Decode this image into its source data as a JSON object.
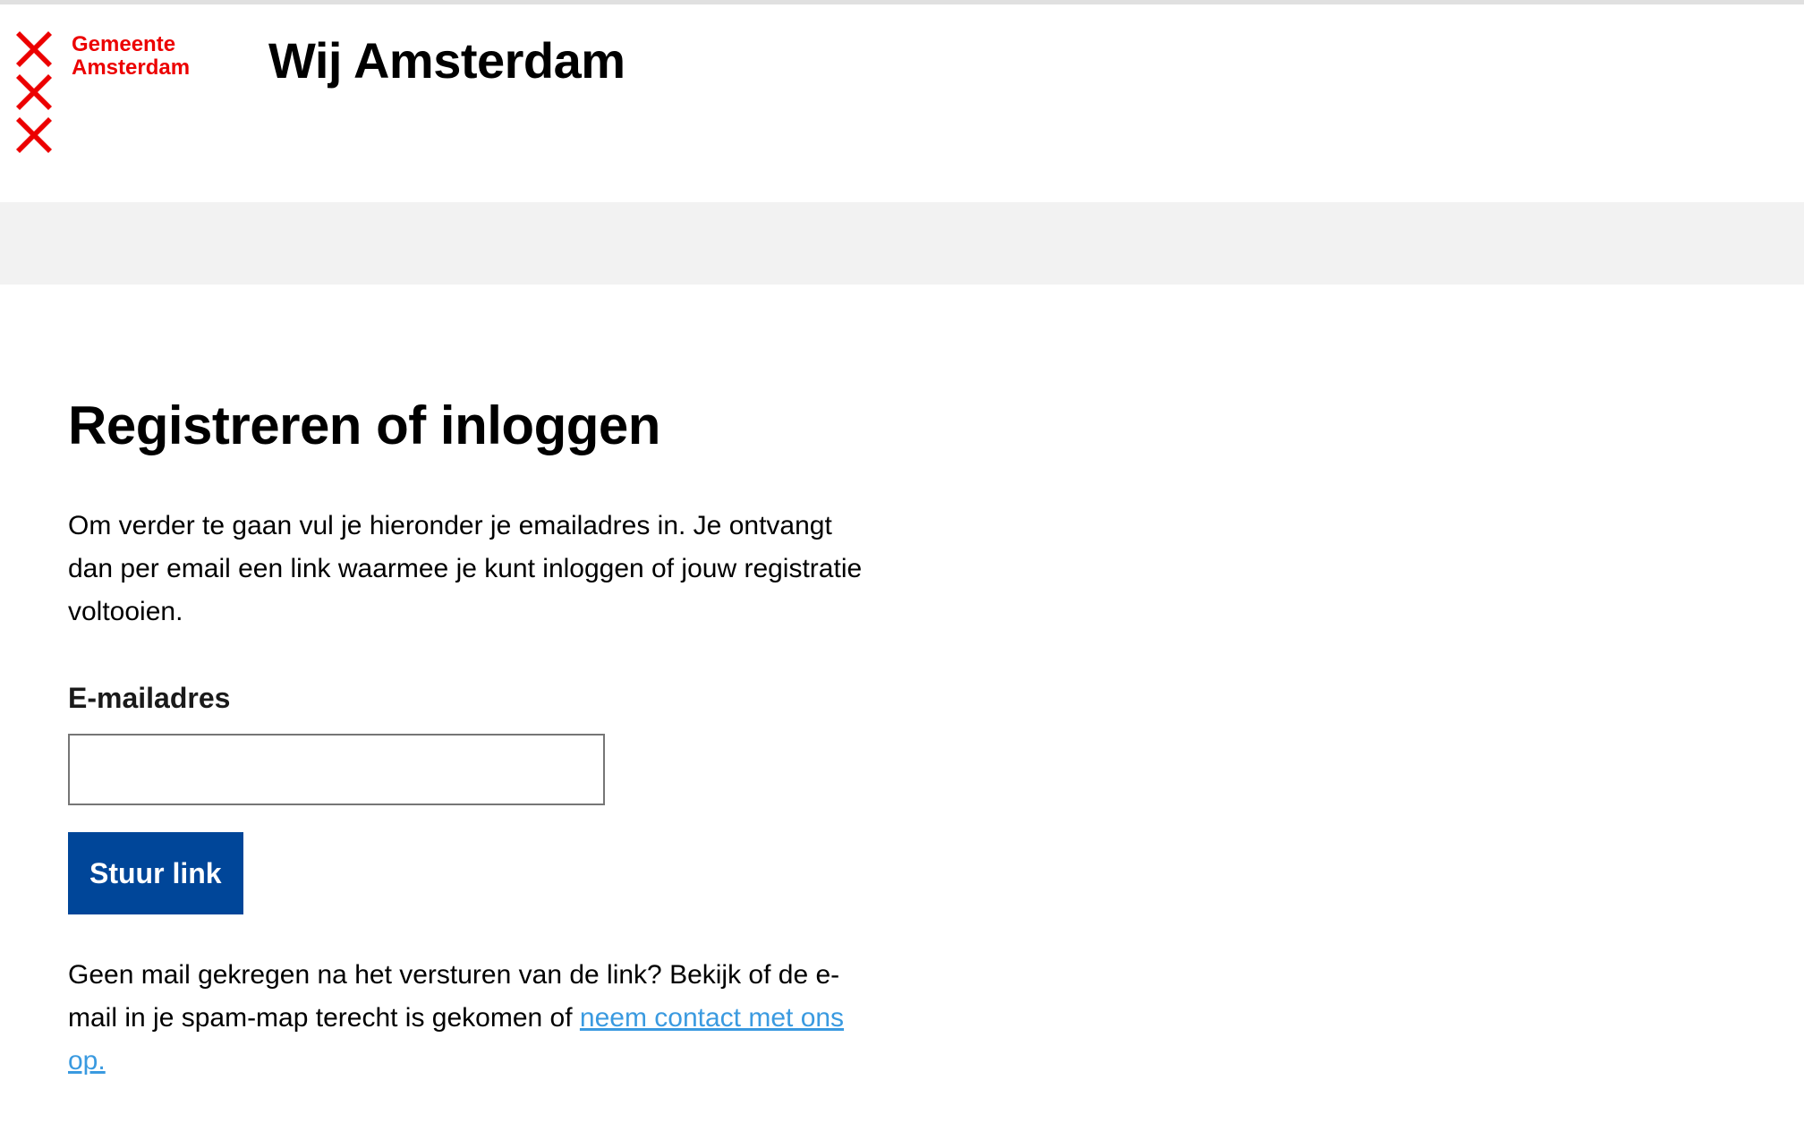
{
  "logo": {
    "line1": "Gemeente",
    "line2": "Amsterdam",
    "brand_color": "#ec0000",
    "icon": "amsterdam-andreas-crosses"
  },
  "header": {
    "site_title": "Wij Amsterdam"
  },
  "main": {
    "title": "Registreren of inloggen",
    "intro": "Om verder te gaan vul je hieronder je emailadres in. Je ontvangt dan per email een link waarmee je kunt inloggen of jouw registratie voltooien.",
    "email_label": "E-mailadres",
    "email_value": "",
    "email_placeholder": "",
    "submit_label": "Stuur link",
    "submit_color": "#004699",
    "help_text": "Geen mail gekregen na het versturen van de link? Bekijk of de e-mail in je spam-map terecht is gekomen of ",
    "help_link": "neem contact met ons op.",
    "link_color": "#3a9ae0"
  }
}
